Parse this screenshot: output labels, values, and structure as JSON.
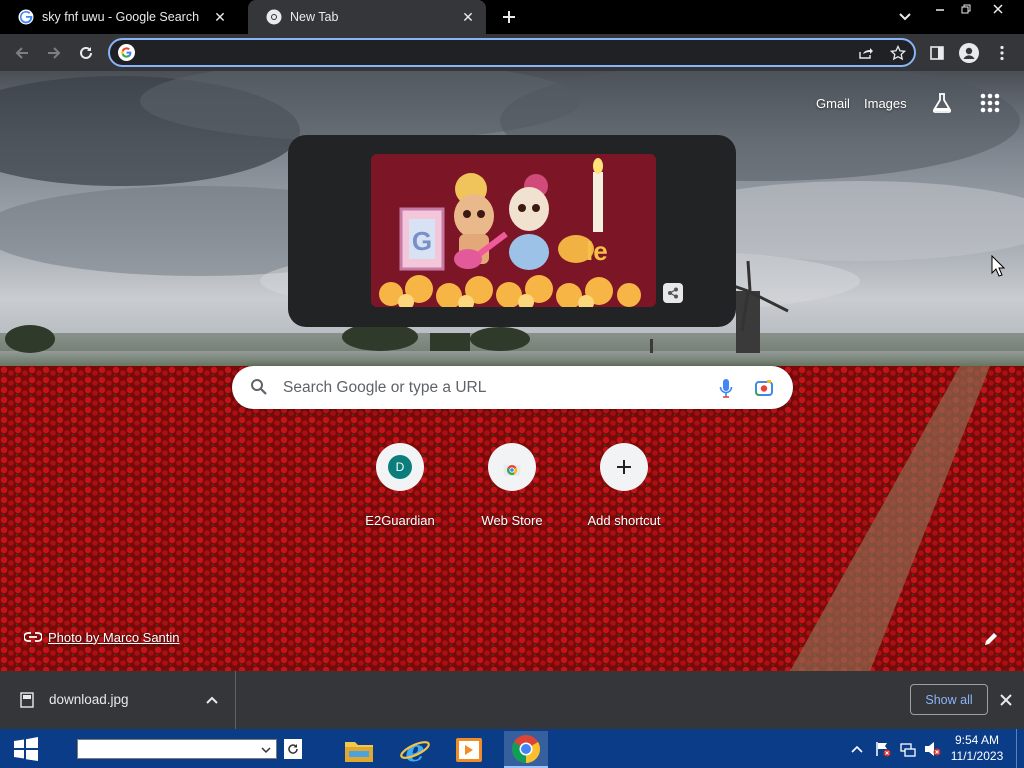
{
  "tabs": [
    {
      "title": "sky fnf uwu - Google Search",
      "active": false
    },
    {
      "title": "New Tab",
      "active": true
    }
  ],
  "omnibox": {
    "value": "",
    "placeholder": ""
  },
  "ntp": {
    "top_links": {
      "gmail": "Gmail",
      "images": "Images"
    },
    "search_placeholder": "Search Google or type a URL",
    "shortcuts": [
      {
        "letter": "D",
        "label": "E2Guardian",
        "icon": "letter-avatar"
      },
      {
        "label": "Web Store",
        "icon": "chrome-web-store-icon"
      },
      {
        "label": "Add shortcut",
        "icon": "plus-icon"
      }
    ],
    "photo_credit": "Photo by Marco Santin"
  },
  "download": {
    "filename": "download.jpg",
    "show_all": "Show all"
  },
  "clock": {
    "time": "9:54 AM",
    "date": "11/1/2023"
  },
  "colors": {
    "accent": "#8ab4f8",
    "toolbar": "#35363a",
    "taskbar": "#0a3c88",
    "avatar_teal": "#0b7d7b"
  }
}
